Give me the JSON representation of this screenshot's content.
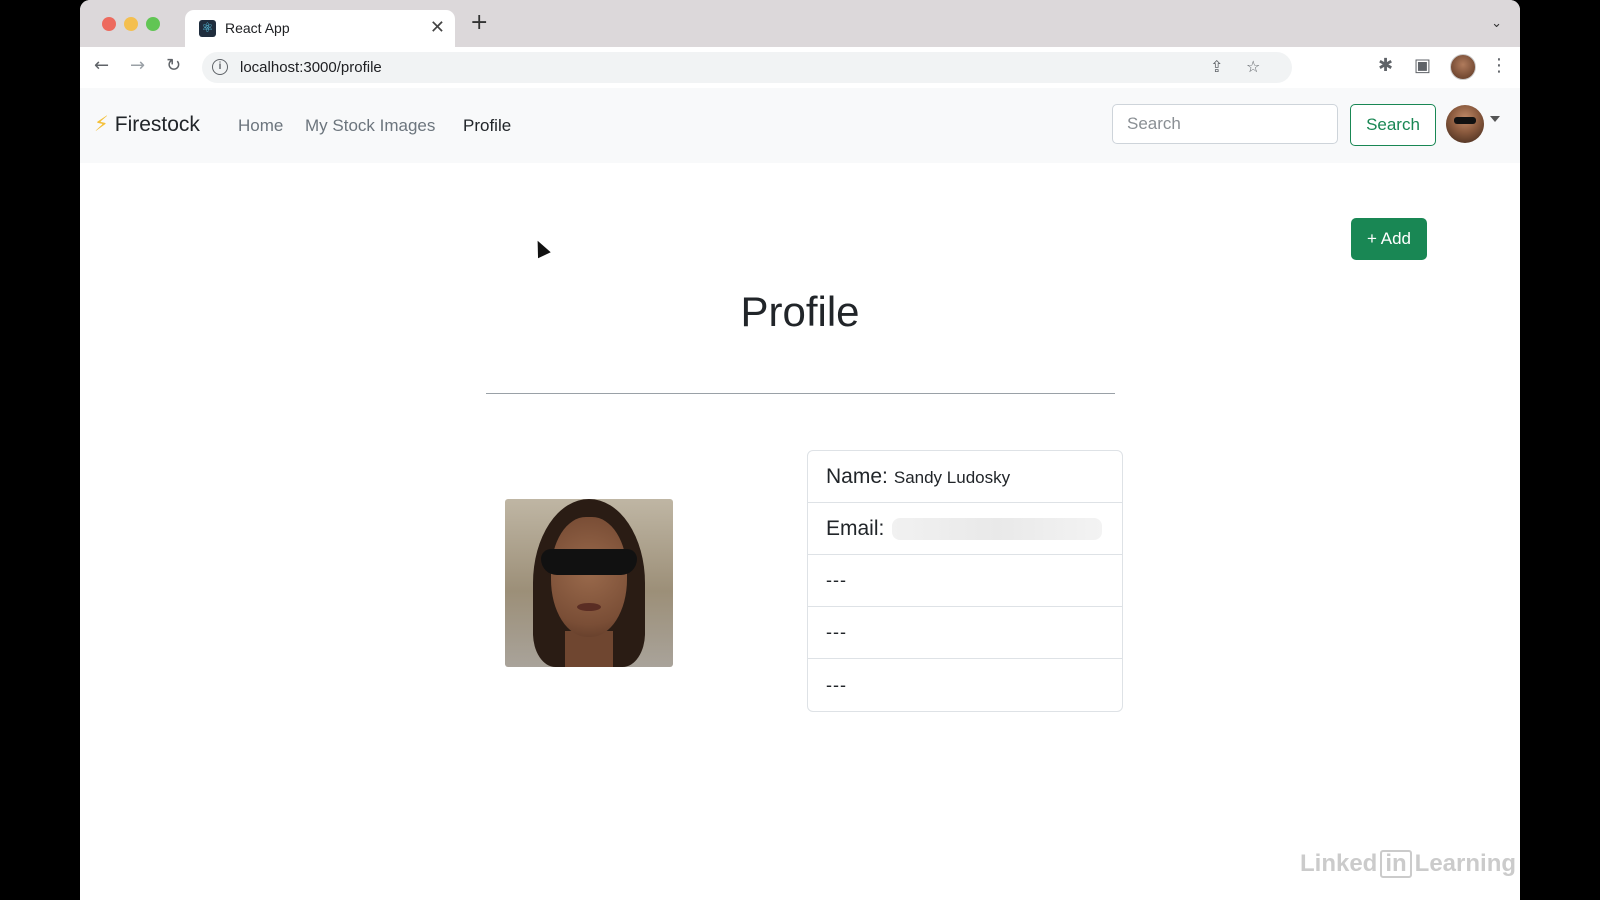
{
  "browser": {
    "tab_title": "React App",
    "tab_close": "✕",
    "new_tab": "+",
    "tab_dropdown": "⌄",
    "url": "localhost:3000/profile",
    "back_icon": "←",
    "forward_icon": "→",
    "reload_icon": "↻",
    "share_icon": "⇪",
    "bookmark_icon": "☆",
    "extensions_icon": "✱",
    "sidepanel_icon": "▣",
    "menu_icon": "⋮",
    "info_icon": "i"
  },
  "navbar": {
    "brand_icon": "⚡",
    "brand": "Firestock",
    "links": [
      "Home",
      "My Stock Images",
      "Profile"
    ],
    "active_link": "Profile",
    "search_placeholder": "Search",
    "search_button": "Search"
  },
  "page": {
    "add_button": "+ Add",
    "title": "Profile",
    "info": {
      "name_label": "Name:",
      "name_value": "Sandy Ludosky",
      "email_label": "Email:",
      "rows": [
        "---",
        "---",
        "---"
      ]
    }
  },
  "watermark": {
    "left": "Linked",
    "in": "in",
    "right": "Learning"
  },
  "colors": {
    "accent": "#198754",
    "navbar_bg": "#f8f9fa",
    "tabstrip_bg": "#dcd8da"
  }
}
